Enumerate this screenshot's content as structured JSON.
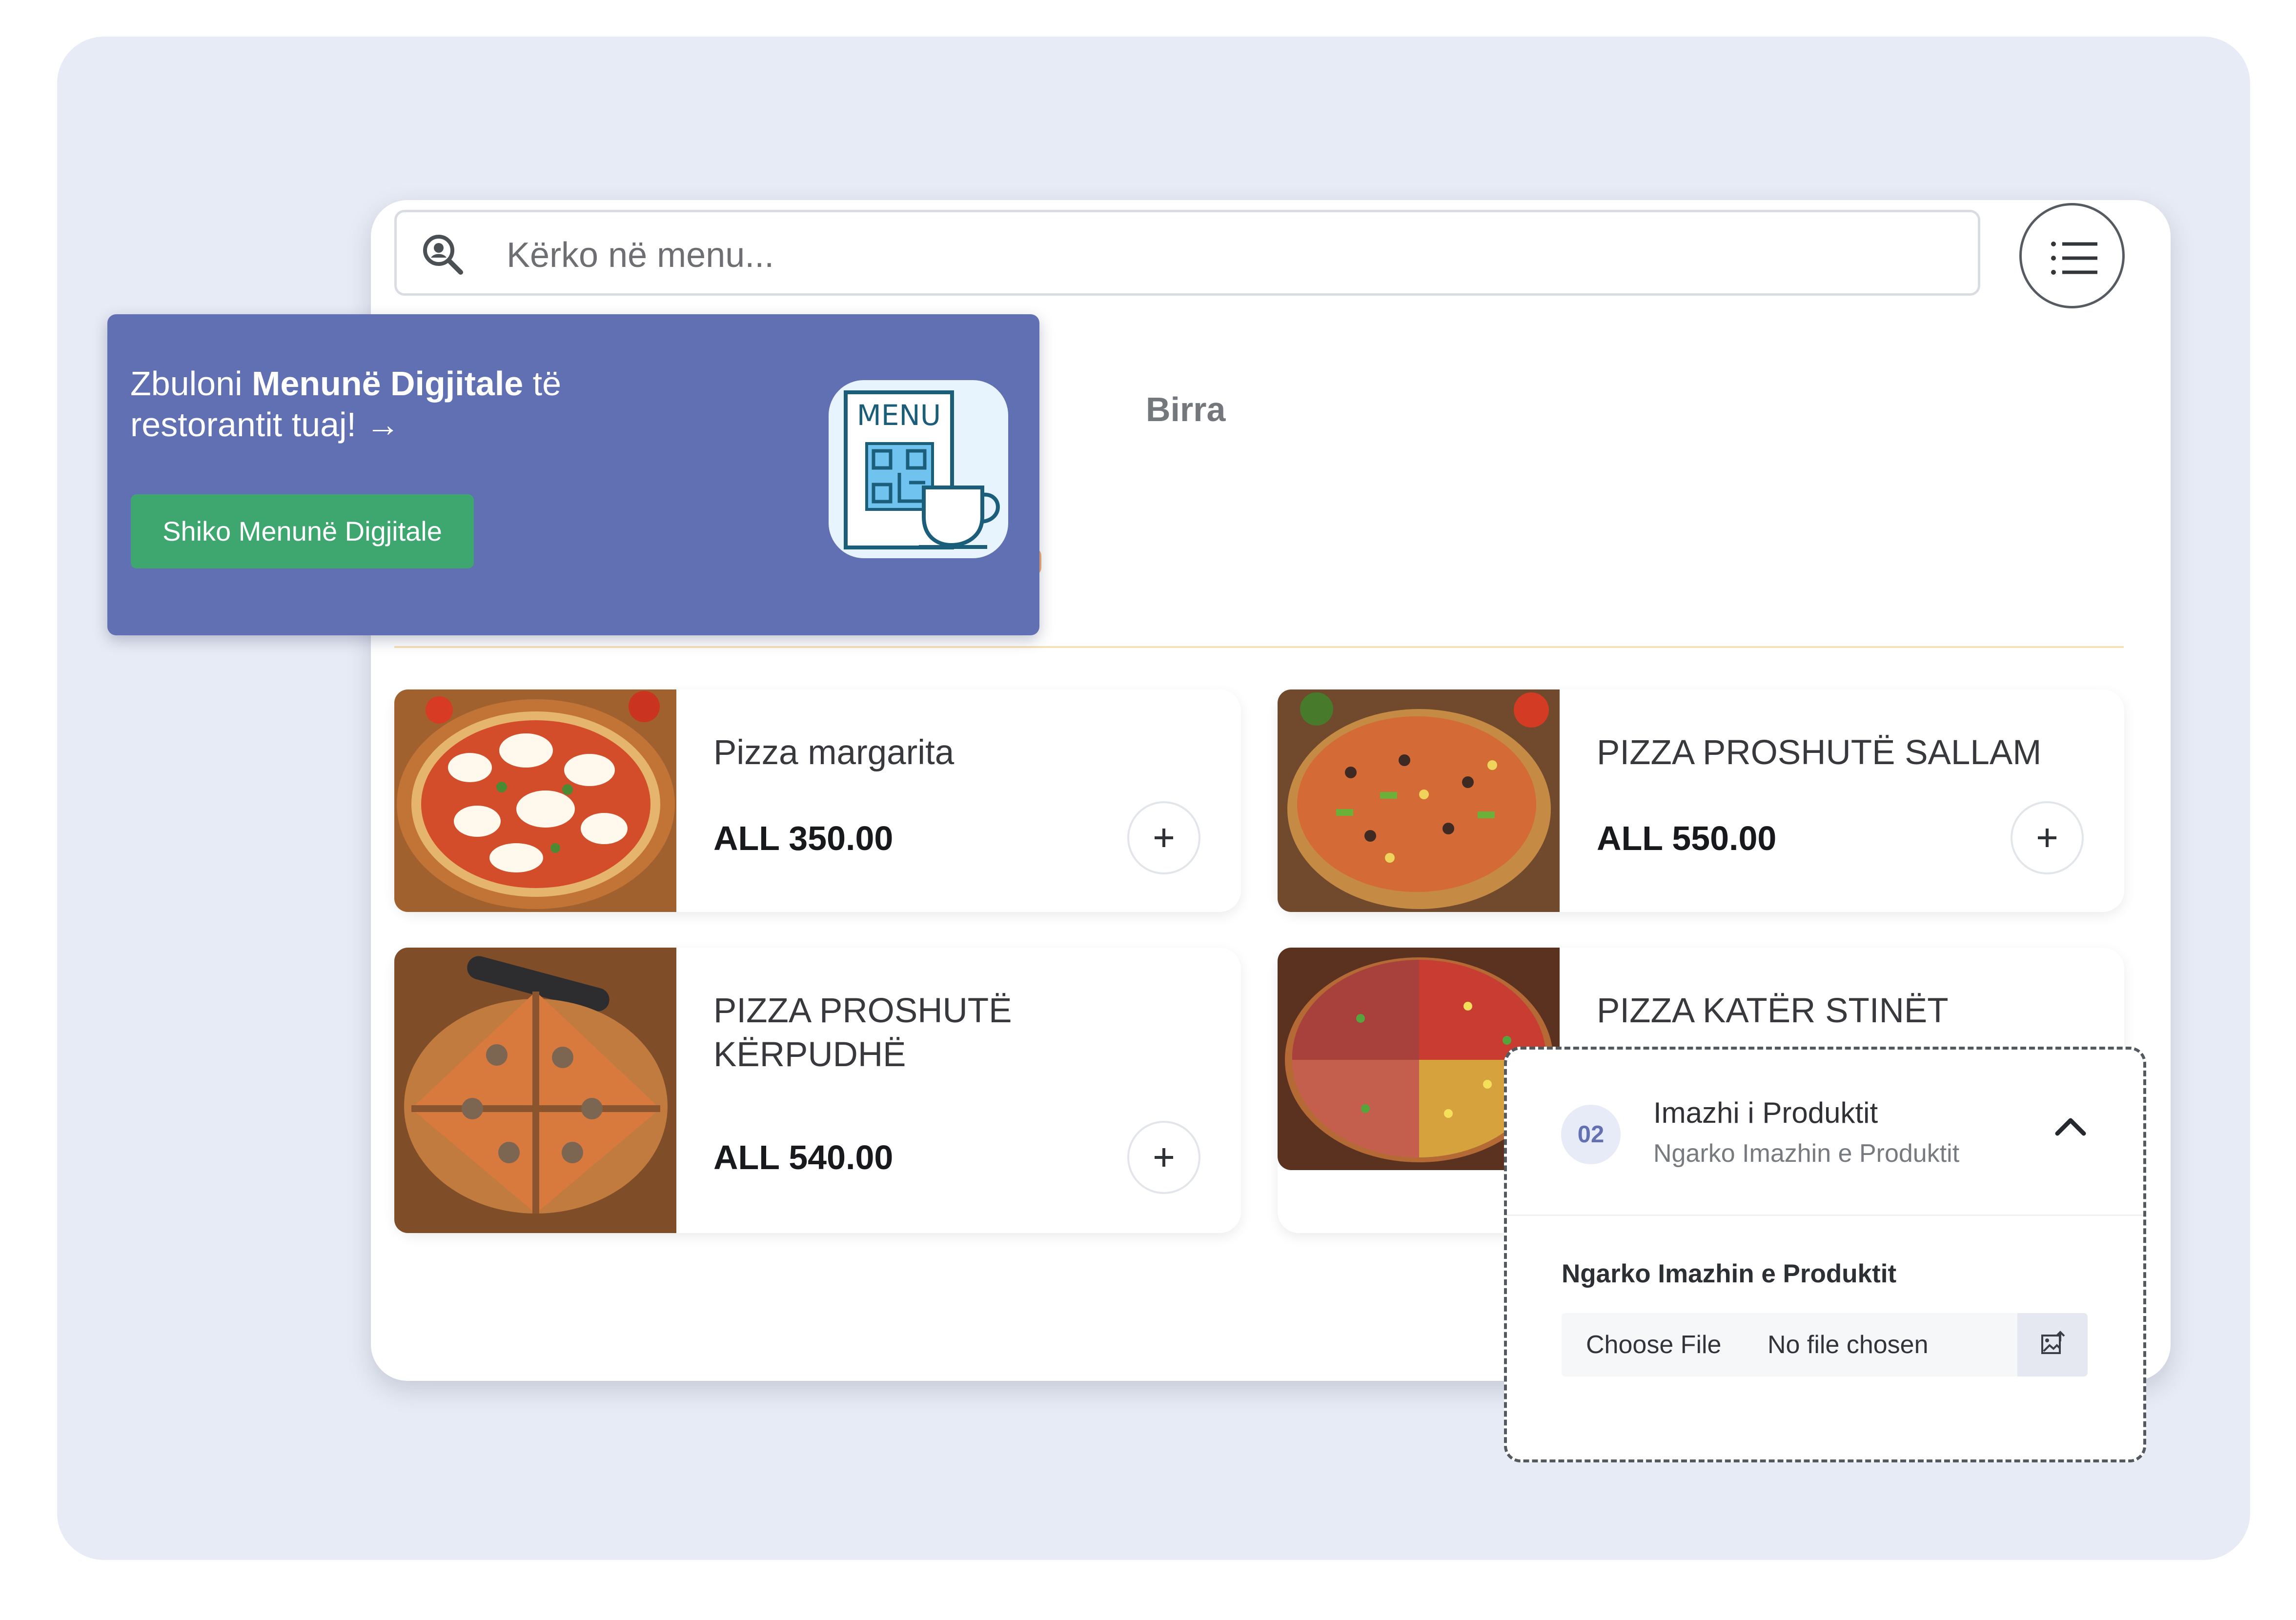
{
  "search": {
    "placeholder": "Kërko në menu..."
  },
  "category_tab": "Birra",
  "promo": {
    "line_1_prefix": "Zbuloni ",
    "line_1_bold": "Menunë Digjitale",
    "line_1_suffix": " të",
    "line_2": "restorantit tuaj!",
    "arrow": "→",
    "button": "Shiko Menunë Digjitale",
    "illustration_label": "MENU"
  },
  "products": [
    {
      "name": "Pizza margarita",
      "price": "ALL 350.00"
    },
    {
      "name": "PIZZA PROSHUTË SALLAM",
      "price": "ALL 550.00"
    },
    {
      "name": "PIZZA PROSHUTË KËRPUDHË",
      "price": "ALL 540.00"
    },
    {
      "name": "PIZZA KATËR STINËT"
    }
  ],
  "upload": {
    "step_number": "02",
    "title": "Imazhi i Produktit",
    "subtitle": "Ngarko Imazhin e Produktit",
    "field_label": "Ngarko Imazhin e Produktit",
    "choose_button": "Choose File",
    "file_status": "No file chosen"
  },
  "icons": {
    "search": "search-icon",
    "menu": "list-menu-icon",
    "upload": "upload-image-icon",
    "chevron": "chevron-up-icon"
  },
  "colors": {
    "background": "#e7ebf5",
    "promo": "#6170b3",
    "promo_button": "#3ea770",
    "step_badge_bg": "#e7ebf7"
  }
}
